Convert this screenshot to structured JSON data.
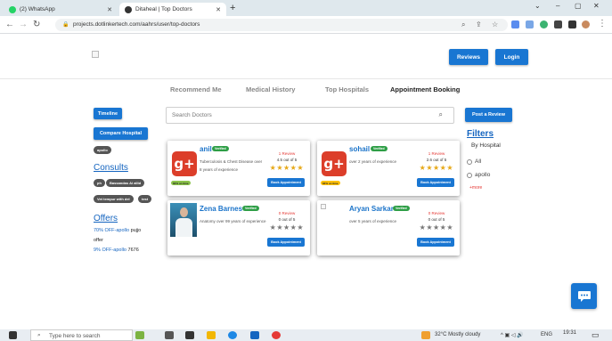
{
  "browser": {
    "tabs": [
      {
        "title": "(2) WhatsApp",
        "active": false
      },
      {
        "title": "Ditaheal | Top Doctors",
        "active": true
      }
    ],
    "url": "projects.dotlinkertech.com/aahrs/user/top-doctors"
  },
  "header": {
    "reviews_label": "Reviews",
    "login_label": "Login"
  },
  "topnav": [
    "Recommend Me",
    "Medical History",
    "Top Hospitals",
    "Appointment Booking"
  ],
  "sidebar": {
    "timeline_label": "Timeline",
    "compare_label": "Compare Hospital",
    "apollo_chip": "apollo",
    "consults_title": "Consults",
    "consult_chips": [
      "ph",
      "Bassandas Ai allid",
      "Vet tempur with del",
      "test"
    ],
    "offers_title": "Offers",
    "offers": [
      {
        "highlight": "70% OFF-apollo",
        "rest": " pujjo"
      },
      {
        "highlight": "",
        "rest": "offer"
      },
      {
        "highlight": "9% OFF-apollo",
        "rest": " 7676"
      }
    ]
  },
  "search": {
    "placeholder": "Search Doctors",
    "post_review_label": "Post a Review"
  },
  "doctors": [
    {
      "name": "anil",
      "verified": "Verified",
      "description": "Tuberculosis & Chest Disease over",
      "experience": "8 years of experience",
      "reviews": "1 Review",
      "rating": "4.5 out of 5",
      "stars": 5,
      "tag": "84% on time",
      "book_label": "Book Appointment"
    },
    {
      "name": "sohail",
      "verified": "Verified",
      "description": "over 2 years of experience",
      "experience": "",
      "reviews": "1 Review",
      "rating": "2.6 out of 5",
      "stars": 5,
      "tag": "84% on time",
      "book_label": "Book Appointment"
    },
    {
      "name": "Zena Barnes",
      "verified": "Verified",
      "description": "Anatomy over 99 years of experience",
      "experience": "",
      "reviews": "0 Review",
      "rating": "0 out of 5",
      "stars": 0,
      "tag": "",
      "book_label": "Book Appointment"
    },
    {
      "name": "Aryan Sarkar",
      "verified": "Verified",
      "description": "over 5 years of experience",
      "experience": "",
      "reviews": "0 Review",
      "rating": "0 out of 5",
      "stars": 0,
      "tag": "",
      "book_label": "Book Appointment"
    }
  ],
  "filters": {
    "title": "Filters",
    "subtitle": "By Hospital",
    "options": [
      "All",
      "apollo"
    ],
    "more_label": "+more"
  },
  "taskbar": {
    "search_placeholder": "Type here to search",
    "weather": "32°C  Mostly cloudy",
    "lang": "ENG",
    "time": "19:31"
  },
  "colors": {
    "primary": "#1976d2",
    "link": "#1565c0",
    "review_red": "#e53935",
    "verified_green": "#2e9e46",
    "google_red": "#dc3e2a"
  }
}
